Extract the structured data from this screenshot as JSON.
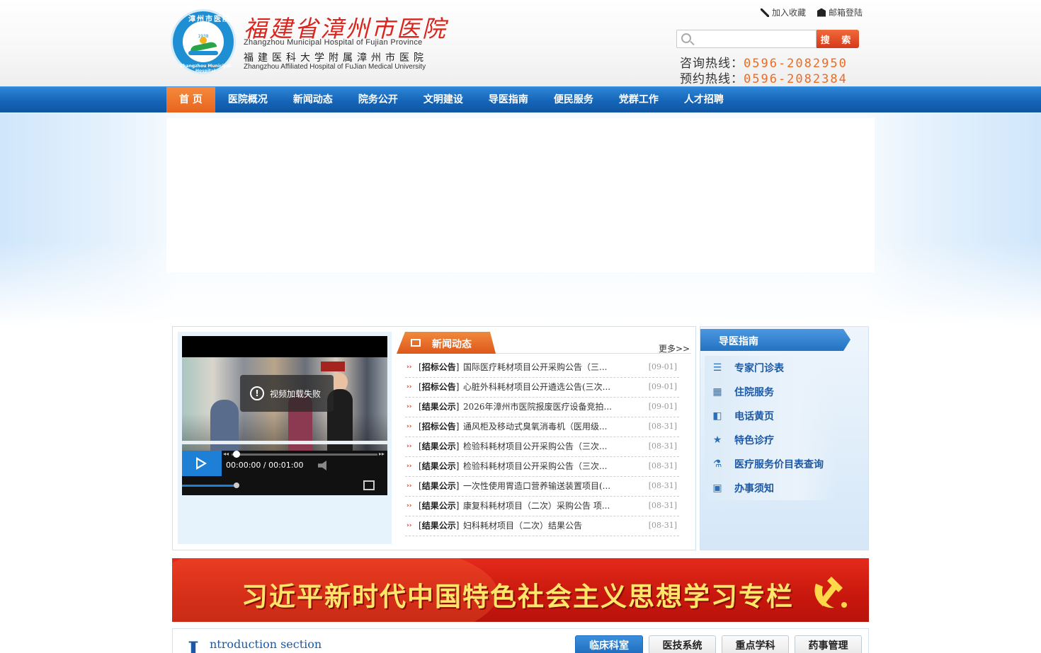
{
  "header": {
    "logo": {
      "ring_text": "漳州市医院",
      "year": "1938",
      "ring_bottom": "Zhangzhou Municipal Hospital"
    },
    "brand_cn": "福建省漳州市医院",
    "brand_en": "Zhangzhou Municipal Hospital of Fujian Province",
    "brand_cn2": "福建医科大学附属漳州市医院",
    "brand_en2": "Zhangzhou Affiliated Hospital of FuJian Medical University",
    "links": {
      "favorite": "加入收藏",
      "mail_login": "邮箱登陆"
    },
    "search": {
      "placeholder": "",
      "button": "搜 索"
    },
    "hotlines": [
      {
        "label": "咨询热线：",
        "number": "0596-2082950"
      },
      {
        "label": "预约热线：",
        "number": "0596-2082384"
      }
    ]
  },
  "nav": {
    "items": [
      {
        "label": "首 页",
        "active": true
      },
      {
        "label": "医院概况"
      },
      {
        "label": "新闻动态"
      },
      {
        "label": "院务公开"
      },
      {
        "label": "文明建设"
      },
      {
        "label": "导医指南"
      },
      {
        "label": "便民服务"
      },
      {
        "label": "党群工作"
      },
      {
        "label": "人才招聘"
      }
    ]
  },
  "video": {
    "error_text": "视频加载失败",
    "time": "00:00:00 / 00:01:00"
  },
  "news": {
    "title": "新闻动态",
    "more": "更多>>",
    "items": [
      {
        "tag": "招标公告",
        "title": "国际医疗耗材项目公开采购公告（三...",
        "date": "[09-01]"
      },
      {
        "tag": "招标公告",
        "title": "心脏外科耗材项目公开遴选公告(三次...",
        "date": "[09-01]"
      },
      {
        "tag": "结果公示",
        "title": "2026年漳州市医院报废医疗设备竞拍...",
        "date": "[09-01]"
      },
      {
        "tag": "招标公告",
        "title": "通风柜及移动式臭氧消毒机（医用级...",
        "date": "[08-31]"
      },
      {
        "tag": "结果公示",
        "title": "检验科耗材项目公开采购公告（三次...",
        "date": "[08-31]"
      },
      {
        "tag": "结果公示",
        "title": "检验科耗材项目公开采购公告（三次...",
        "date": "[08-31]"
      },
      {
        "tag": "结果公示",
        "title": "一次性使用胃造口营养输送装置项目(...",
        "date": "[08-31]"
      },
      {
        "tag": "结果公示",
        "title": "康复科耗材项目（二次）采购公告 项...",
        "date": "[08-31]"
      },
      {
        "tag": "结果公示",
        "title": "妇科耗材项目（二次）结果公告",
        "date": "[08-31]"
      }
    ]
  },
  "guide": {
    "title": "导医指南",
    "items": [
      {
        "label": "专家门诊表",
        "icon": "list-icon"
      },
      {
        "label": "住院服务",
        "icon": "building-icon"
      },
      {
        "label": "电话黄页",
        "icon": "phonebook-icon"
      },
      {
        "label": "特色诊疗",
        "icon": "star-icon"
      },
      {
        "label": "医疗服务价目表查询",
        "icon": "flask-icon"
      },
      {
        "label": "办事须知",
        "icon": "notice-board-icon"
      }
    ]
  },
  "party_banner": {
    "text": "习近平新时代中国特色社会主义思想学习专栏"
  },
  "intro": {
    "big_letter": "I",
    "en": "ntroduction section",
    "tabs": [
      {
        "label": "临床科室",
        "active": true
      },
      {
        "label": "医技系统"
      },
      {
        "label": "重点学科"
      },
      {
        "label": "药事管理"
      }
    ]
  },
  "colors": {
    "nav_blue": "#1565b8",
    "nav_active": "#e8641e",
    "brand_red": "#d8261e",
    "hotline_orange": "#ef6b1f",
    "guide_text": "#1d58a5"
  }
}
